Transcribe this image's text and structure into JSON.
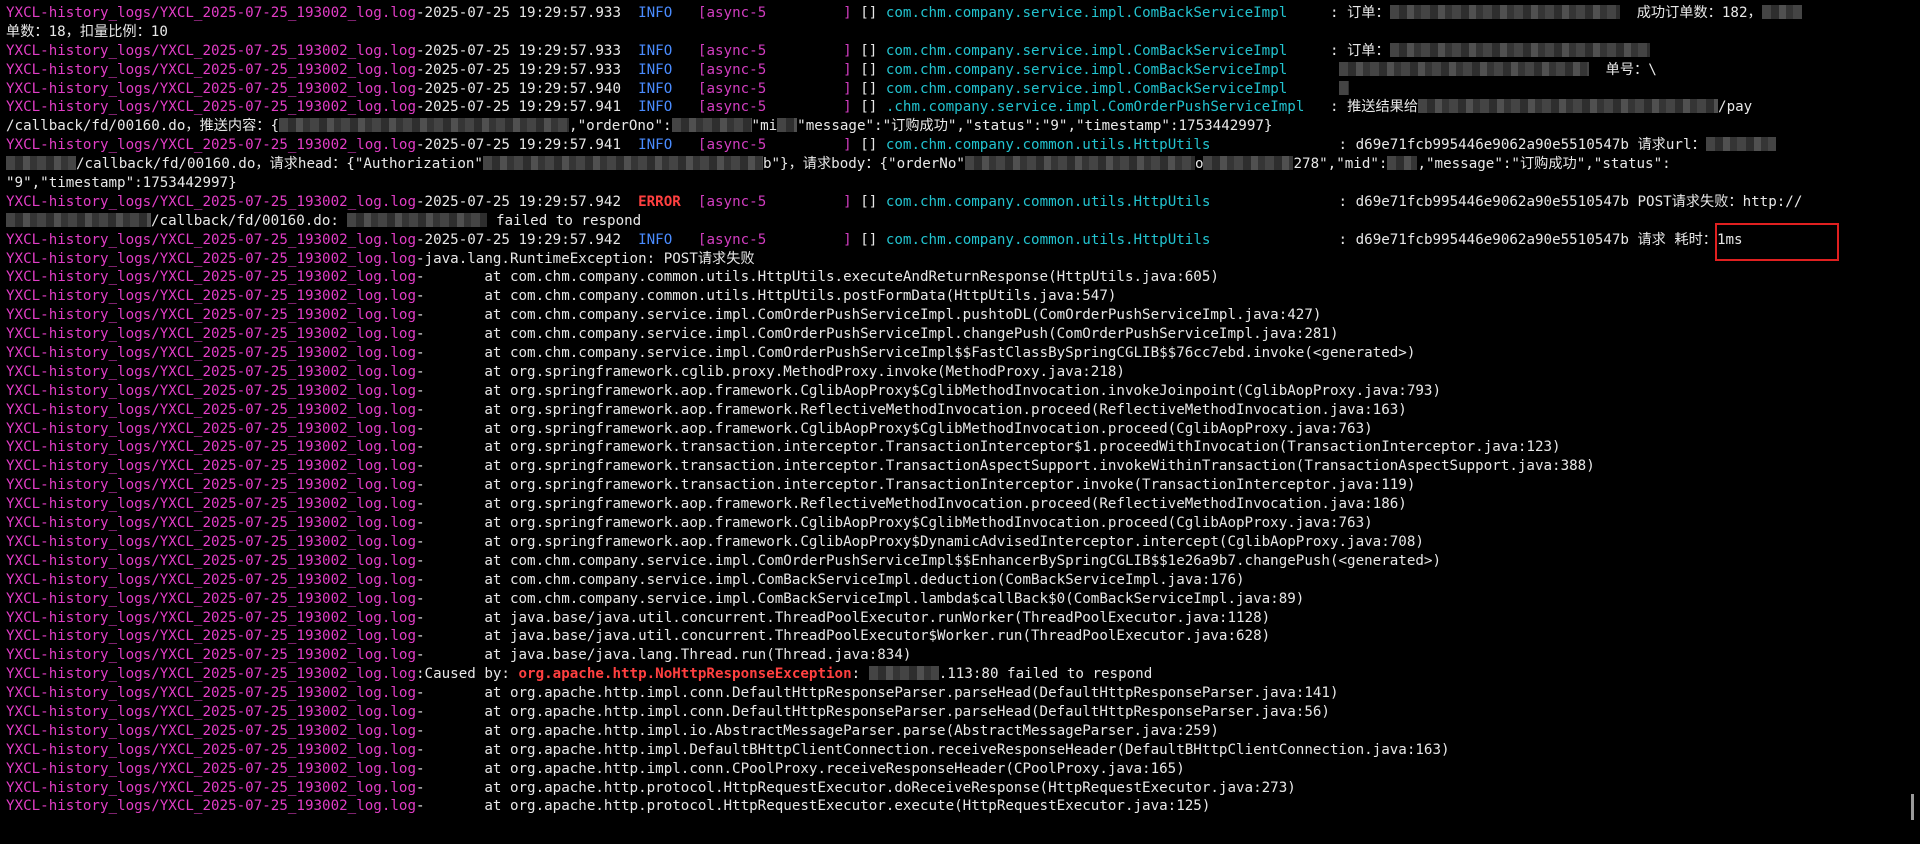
{
  "log_source": "YXCL-history_logs/YXCL_2025-07-25_193002_log.log",
  "header_lines": [
    {
      "ts": "-2025-07-25 19:29:57.933",
      "level": "INFO",
      "thread": "[async-5         ]",
      "ctx": " [] ",
      "logger": "com.chm.company.service.impl.ComBackServiceImpl    ",
      "msg": " : 订单：",
      "redact": 230,
      "tail": "  成功订单数：182，",
      "redact2": 40
    },
    {
      "wrap": "单数：18，扣量比例：10"
    },
    {
      "ts": "-2025-07-25 19:29:57.933",
      "level": "INFO",
      "thread": "[async-5         ]",
      "ctx": " [] ",
      "logger": "com.chm.company.service.impl.ComBackServiceImpl    ",
      "msg": " : 订单：",
      "redact": 260
    },
    {
      "ts": "-2025-07-25 19:29:57.933",
      "level": "INFO",
      "thread": "[async-5         ]",
      "ctx": " [] ",
      "logger": "com.chm.company.service.impl.ComBackServiceImpl    ",
      "msg": "  ",
      "redact": 250,
      "tail": "  单号：\\"
    },
    {
      "ts": "-2025-07-25 19:29:57.940",
      "level": "INFO",
      "thread": "[async-5         ]",
      "ctx": " [] ",
      "logger": "com.chm.company.service.impl.ComBackServiceImpl    ",
      "msg": "  ",
      "redact": 10
    },
    {
      "ts": "-2025-07-25 19:29:57.941",
      "level": "INFO",
      "thread": "[async-5         ]",
      "ctx": " [] ",
      "logger": ".chm.company.service.impl.ComOrderPushServiceImpl  ",
      "msg": " : 推送结果给",
      "redact": 300,
      "tail": "/pay"
    },
    {
      "wrap": "/callback/fd/00160.do，推送内容：{",
      "redact": 290,
      "tail": ",\"orderOno\":",
      "redact2": 80,
      "tail2": "\"mi",
      "redact3": 20,
      "tail3": "\"message\":\"订购成功\",\"status\":\"9\",\"timestamp\":1753442997}"
    },
    {
      "ts": "-2025-07-25 19:29:57.941",
      "level": "INFO",
      "thread": "[async-5         ]",
      "ctx": " [] ",
      "logger": "com.chm.company.common.utils.HttpUtils              ",
      "msg": " : d69e71fcb995446e9062a90e5510547b 请求url：",
      "redact": 70
    },
    {
      "wrap": "",
      "redact": 70,
      "tail": "/callback/fd/00160.do，请求head：{\"Authorization\"",
      "redact2": 280,
      "tail2": "b\"}，请求body：{\"orderNo\"",
      "redact3": 230,
      "tail3": "o",
      "redact4": 90,
      "tail4": "278\",\"mid\":",
      "redact5": 30,
      "tail5": ",\"message\":\"订购成功\",\"status\":"
    },
    {
      "wrap": "\"9\",\"timestamp\":1753442997}"
    },
    {
      "ts": "-2025-07-25 19:29:57.942",
      "level": "ERROR",
      "thread": "[async-5         ]",
      "ctx": " [] ",
      "logger": "com.chm.company.common.utils.HttpUtils              ",
      "msg": " : d69e71fcb995446e9062a90e5510547b POST请求失败：http://"
    },
    {
      "wrap": "",
      "redact": 145,
      "tail": "/callback/fd/00160.do: ",
      "redact2": 140,
      "tail2": " failed to respond"
    },
    {
      "ts": "-2025-07-25 19:29:57.942",
      "level": "INFO",
      "thread": "[async-5         ]",
      "ctx": " [] ",
      "logger": "com.chm.company.common.utils.HttpUtils              ",
      "msg": " : d69e71fcb995446e9062a90e5510547b 请求 耗时：1ms"
    }
  ],
  "exception_line": "java.lang.RuntimeException: POST请求失败",
  "stack_top": [
    "       at com.chm.company.common.utils.HttpUtils.executeAndReturnResponse(HttpUtils.java:605)",
    "       at com.chm.company.common.utils.HttpUtils.postFormData(HttpUtils.java:547)",
    "       at com.chm.company.service.impl.ComOrderPushServiceImpl.pushtoDL(ComOrderPushServiceImpl.java:427)",
    "       at com.chm.company.service.impl.ComOrderPushServiceImpl.changePush(ComOrderPushServiceImpl.java:281)",
    "       at com.chm.company.service.impl.ComOrderPushServiceImpl$$FastClassBySpringCGLIB$$76cc7ebd.invoke(<generated>)",
    "       at org.springframework.cglib.proxy.MethodProxy.invoke(MethodProxy.java:218)",
    "       at org.springframework.aop.framework.CglibAopProxy$CglibMethodInvocation.invokeJoinpoint(CglibAopProxy.java:793)",
    "       at org.springframework.aop.framework.ReflectiveMethodInvocation.proceed(ReflectiveMethodInvocation.java:163)",
    "       at org.springframework.aop.framework.CglibAopProxy$CglibMethodInvocation.proceed(CglibAopProxy.java:763)",
    "       at org.springframework.transaction.interceptor.TransactionInterceptor$1.proceedWithInvocation(TransactionInterceptor.java:123)",
    "       at org.springframework.transaction.interceptor.TransactionAspectSupport.invokeWithinTransaction(TransactionAspectSupport.java:388)",
    "       at org.springframework.transaction.interceptor.TransactionInterceptor.invoke(TransactionInterceptor.java:119)",
    "       at org.springframework.aop.framework.ReflectiveMethodInvocation.proceed(ReflectiveMethodInvocation.java:186)",
    "       at org.springframework.aop.framework.CglibAopProxy$CglibMethodInvocation.proceed(CglibAopProxy.java:763)",
    "       at org.springframework.aop.framework.CglibAopProxy$DynamicAdvisedInterceptor.intercept(CglibAopProxy.java:708)",
    "       at com.chm.company.service.impl.ComOrderPushServiceImpl$$EnhancerBySpringCGLIB$$1e26a9b7.changePush(<generated>)",
    "       at com.chm.company.service.impl.ComBackServiceImpl.deduction(ComBackServiceImpl.java:176)",
    "       at com.chm.company.service.impl.ComBackServiceImpl.lambda$callBack$0(ComBackServiceImpl.java:89)",
    "       at java.base/java.util.concurrent.ThreadPoolExecutor.runWorker(ThreadPoolExecutor.java:1128)",
    "       at java.base/java.util.concurrent.ThreadPoolExecutor$Worker.run(ThreadPoolExecutor.java:628)",
    "       at java.base/java.lang.Thread.run(Thread.java:834)"
  ],
  "caused_by": {
    "prefix": "Caused by: ",
    "exception": "org.apache.http.NoHttpResponseException",
    "sep": ": ",
    "redact": 70,
    "tail": ".113:80 failed to respond"
  },
  "stack_bottom": [
    "       at org.apache.http.impl.conn.DefaultHttpResponseParser.parseHead(DefaultHttpResponseParser.java:141)",
    "       at org.apache.http.impl.conn.DefaultHttpResponseParser.parseHead(DefaultHttpResponseParser.java:56)",
    "       at org.apache.http.impl.io.AbstractMessageParser.parse(AbstractMessageParser.java:259)",
    "       at org.apache.http.impl.DefaultBHttpClientConnection.receiveResponseHeader(DefaultBHttpClientConnection.java:163)",
    "       at org.apache.http.impl.conn.CPoolProxy.receiveResponseHeader(CPoolProxy.java:165)",
    "       at org.apache.http.protocol.HttpRequestExecutor.doReceiveResponse(HttpRequestExecutor.java:273)",
    "       at org.apache.http.protocol.HttpRequestExecutor.execute(HttpRequestExecutor.java:125)"
  ],
  "colors": {
    "background": "#000000",
    "source": "#e23dc6",
    "info": "#4a8cff",
    "error": "#ff4040",
    "logger": "#22c3cf",
    "text": "#e8e8e8",
    "highlight": "#e02020"
  }
}
